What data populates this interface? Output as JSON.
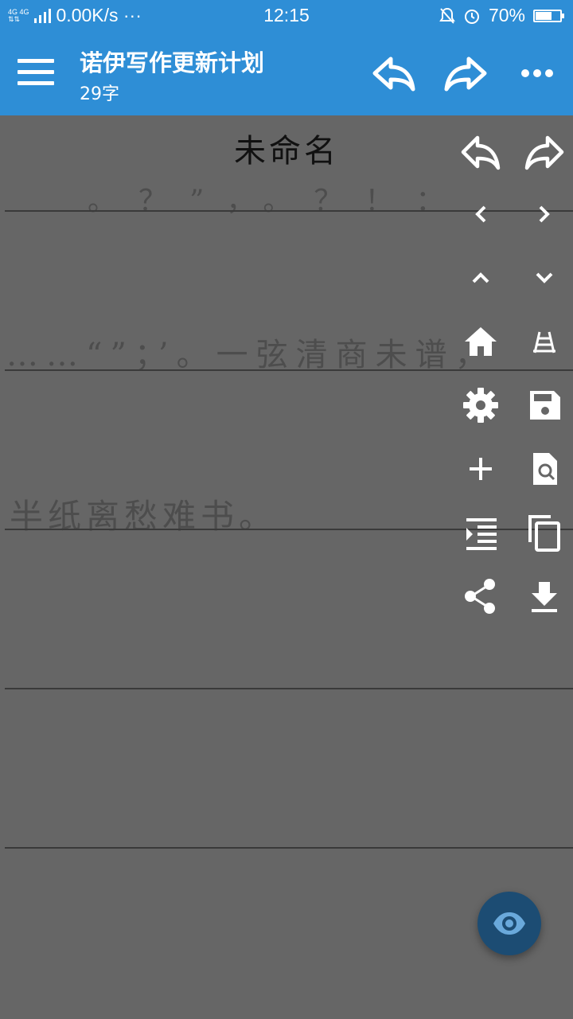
{
  "status": {
    "network": "4G 4G",
    "speed": "0.00K/s ···",
    "time": "12:15",
    "battery": "70%",
    "battery_level": 0.7
  },
  "appbar": {
    "title": "诺伊写作更新计划",
    "subtitle": "29字",
    "icons": [
      "menu-icon",
      "undo-icon",
      "redo-icon",
      "more-icon"
    ]
  },
  "editor": {
    "doc_title": "未命名",
    "ghost_lines": [
      "。？”，。？！：",
      "……“”；’。一弦清商未谱，",
      "半纸离愁难书。"
    ]
  },
  "toolbar": {
    "icons": [
      "undo-icon",
      "redo-icon",
      "chevron-left-icon",
      "chevron-right-icon",
      "chevron-up-icon",
      "chevron-down-icon",
      "home-icon",
      "railway-icon",
      "gear-icon",
      "save-icon",
      "add-icon",
      "find-file-icon",
      "indent-icon",
      "copy-icon",
      "share-icon",
      "download-icon"
    ]
  },
  "fab": {
    "icon": "eye-icon"
  },
  "colors": {
    "appbar": "#2e8ed6",
    "background": "#666666",
    "fab": "#1c4c73"
  }
}
